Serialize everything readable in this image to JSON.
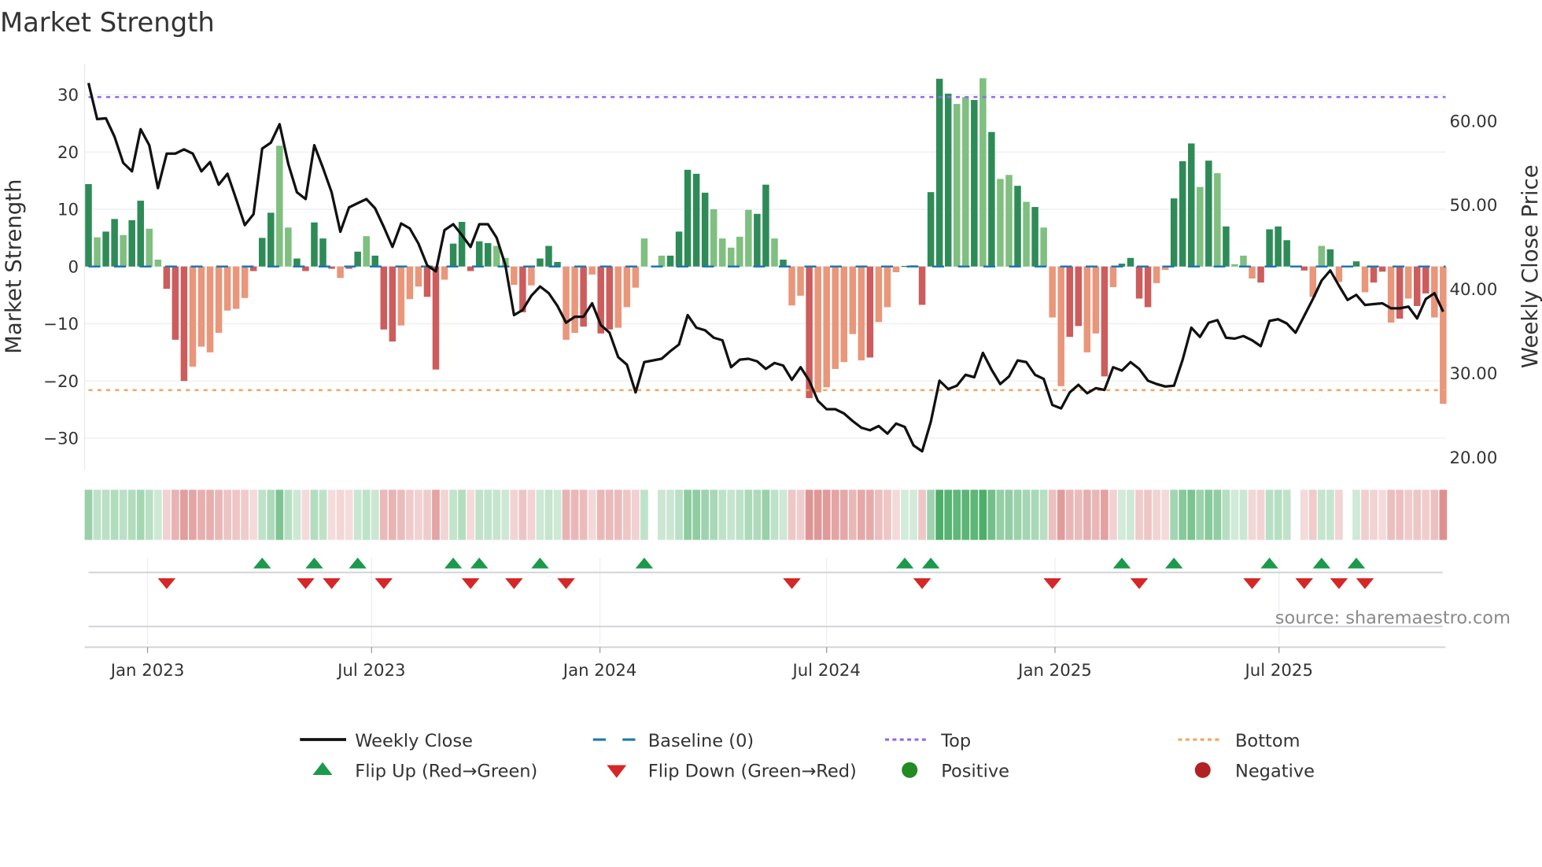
{
  "chart_data": {
    "type": "bar",
    "title": "Market Strength",
    "ylabel": "Market Strength",
    "y2label": "Weekly Close Price",
    "ylim": [
      -35.6,
      35.4
    ],
    "y2lim": [
      18.4,
      66.7
    ],
    "yticks": [
      30,
      20,
      10,
      0,
      -10,
      -20,
      -30
    ],
    "ytick_labels": [
      "30",
      "20",
      "10",
      "0",
      "−10",
      "−20",
      "−30"
    ],
    "y2ticks": [
      60,
      50,
      40,
      30,
      20
    ],
    "y2tick_labels": [
      "60.00",
      "50.00",
      "40.00",
      "30.00",
      "20.00"
    ],
    "x_unit": "week index (weekly, Nov 2022 – Nov 2025)",
    "xticks": [
      6.8,
      32.6,
      58.9,
      85.0,
      111.3,
      137.1
    ],
    "xtick_labels": [
      "Jan 2023",
      "Jul 2023",
      "Jan 2024",
      "Jul 2024",
      "Jan 2025",
      "Jul 2025"
    ],
    "top_level": 29.6,
    "bottom_level": -21.6,
    "baseline": 0,
    "strength": [
      14.4,
      5.1,
      6.1,
      8.3,
      5.5,
      8.1,
      11.5,
      6.6,
      1.2,
      -3.9,
      -12.8,
      -20,
      -17.5,
      -14,
      -15,
      -11.6,
      -7.7,
      -7.4,
      -5.5,
      -0.8,
      5.0,
      9.4,
      21.1,
      6.8,
      1.4,
      -0.8,
      7.7,
      4.9,
      -0.4,
      -2,
      -0.4,
      2.6,
      5.3,
      1.9,
      -11,
      -13.1,
      -10.3,
      -5.7,
      -3.5,
      -5.3,
      -18,
      -2.3,
      4.0,
      7.8,
      -0.8,
      4.4,
      4.1,
      3.6,
      1.5,
      -3.2,
      -8,
      -3.3,
      1.4,
      3.6,
      0.8,
      -12.8,
      -11.6,
      -10.5,
      -1.4,
      -11.7,
      -11,
      -10.7,
      -7.1,
      -3.7,
      4.9,
      0,
      1.9,
      1.9,
      6.1,
      16.9,
      16.2,
      12.9,
      10,
      4.9,
      3.3,
      5.2,
      9.9,
      9.2,
      14.3,
      4.9,
      1.2,
      -6.8,
      -5.1,
      -23,
      -22,
      -21.1,
      -17.9,
      -16.7,
      -11.8,
      -16.4,
      -15.9,
      -9.7,
      -7.1,
      -1,
      0.1,
      0.2,
      -6.7,
      13,
      32.8,
      30.2,
      28.4,
      29.6,
      29.1,
      32.9,
      23.5,
      15.3,
      16,
      14.1,
      11.3,
      10.4,
      6.8,
      -8.9,
      -20.9,
      -12.3,
      -10.4,
      -15,
      -11.7,
      -19.2,
      -3.6,
      0.5,
      1.5,
      -5.6,
      -7.1,
      -2.9,
      -0.6,
      11.9,
      18.4,
      21.5,
      13.9,
      18.5,
      16.3,
      7,
      0.4,
      1.9,
      -2.1,
      -2.8,
      6.5,
      7,
      4.6,
      0,
      -0.7,
      -5.3,
      3.6,
      3,
      -2.7,
      0,
      0.9,
      -4.5,
      -2.8,
      -0.9,
      -9.8,
      -9.1,
      -5.6,
      -6.9,
      -4.7,
      -8.9,
      -24
    ],
    "strength_shade": "dlddlddlldddllllllldddlldddddlddldddlllddldddddllldldddlldlddlllldldddddlllllddldlldlllllldlllddddddlldldlldldlllddlldlddddlldddldldlllddddddlldlddlddldlddllldlldld",
    "weekly_close": [
      64.4,
      60.1,
      60.2,
      58,
      54.9,
      53.9,
      58.9,
      57,
      51.9,
      56,
      56,
      56.5,
      56,
      53.9,
      55,
      52.3,
      53.6,
      50.6,
      47.5,
      48.8,
      56.6,
      57.3,
      59.5,
      54.8,
      51.4,
      50.6,
      57,
      54.3,
      51.4,
      46.7,
      49.6,
      50.1,
      50.6,
      49.5,
      47.3,
      44.9,
      47.7,
      47.1,
      45.3,
      42.7,
      42,
      46.9,
      47.6,
      46.3,
      44.9,
      47.6,
      47.6,
      46,
      42.8,
      36.8,
      37.4,
      39.1,
      40.2,
      39.4,
      37.9,
      35.9,
      36.6,
      36.6,
      38.2,
      35.6,
      34.7,
      31.8,
      30.9,
      27.6,
      31.2,
      31.4,
      31.6,
      32.5,
      33.3,
      36.8,
      35.3,
      35,
      34.1,
      33.8,
      30.6,
      31.5,
      31.6,
      31.3,
      30.4,
      31.1,
      30.8,
      29.1,
      30.6,
      29,
      26.6,
      25.6,
      25.6,
      25.1,
      24.2,
      23.4,
      23.1,
      23.6,
      22.7,
      23.9,
      23.5,
      21.3,
      20.6,
      24.1,
      29,
      28,
      28.4,
      29.7,
      29.4,
      32.3,
      30.3,
      28.6,
      29.5,
      31.4,
      31.2,
      29.7,
      29.2,
      26.1,
      25.7,
      27.6,
      28.5,
      27.5,
      28.1,
      27.9,
      30.6,
      30.2,
      31.2,
      30.4,
      29,
      28.6,
      28.3,
      28.4,
      31.5,
      35.3,
      34.2,
      35.9,
      36.2,
      34.1,
      34,
      34.3,
      33.8,
      33.1,
      36.1,
      36.3,
      35.8,
      34.7,
      36.7,
      38.7,
      40.9,
      42.1,
      40.3,
      38.6,
      39.2,
      38,
      38.1,
      38.2,
      37.6,
      37.6,
      37.8,
      36.4,
      38.7,
      39.4,
      37.2
    ],
    "flip_up_weeks": [
      20,
      26,
      31,
      42,
      45,
      52,
      64,
      94,
      97,
      119,
      125,
      136,
      142,
      146
    ],
    "flip_down_weeks": [
      9,
      25,
      28,
      34,
      44,
      49,
      55,
      81,
      96,
      111,
      121,
      134,
      140,
      144,
      147
    ],
    "legend": {
      "placement": "bottom",
      "items": [
        "Weekly Close",
        "Baseline (0)",
        "Top",
        "Bottom",
        "Flip Up (Red→Green)",
        "Flip Down (Green→Red)",
        "Positive",
        "Negative"
      ]
    },
    "source": "source: sharemaestro.com",
    "colors": {
      "strong_pos": "#2e8b57",
      "weak_pos": "#7fbf7f",
      "strong_neg": "#cd5c5c",
      "weak_neg": "#e9967a",
      "close": "#111111",
      "baseline": "#1f77b4",
      "top": "#9467f0",
      "bottom": "#f4a460",
      "flip_up": "#1a9a4a",
      "flip_down": "#d62728",
      "positive": "#228b22",
      "negative": "#b22222"
    }
  }
}
